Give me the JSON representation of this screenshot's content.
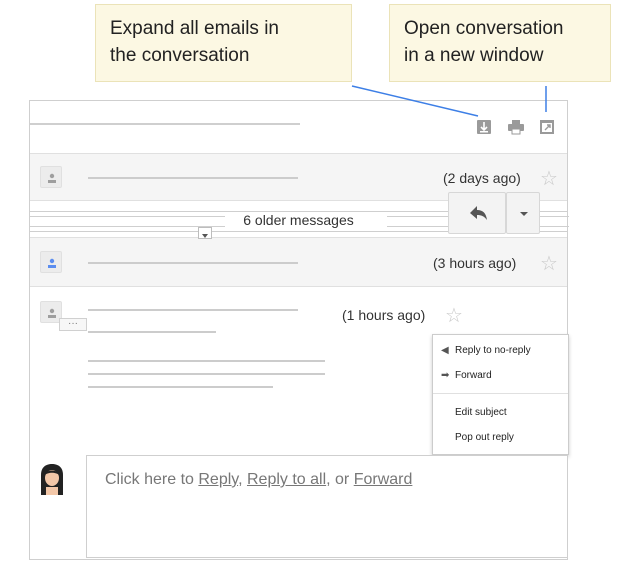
{
  "callouts": {
    "expand": {
      "line1": "Expand all emails in",
      "line2": "the conversation"
    },
    "open": {
      "line1": "Open conversation",
      "line2": "in a new window"
    }
  },
  "toolbar": {
    "icons": [
      "expand-all-icon",
      "print-icon",
      "open-in-new-window-icon"
    ]
  },
  "messages": [
    {
      "time": "(2 days ago)",
      "state": "collapsed",
      "avatar_color": "#9e9e9e"
    },
    {
      "time": "(3 hours ago)",
      "state": "collapsed",
      "avatar_color": "#5b8def"
    },
    {
      "time": "(1 hours ago)",
      "state": "expanded",
      "avatar_color": "#9e9e9e"
    }
  ],
  "older_messages": {
    "label": "6 older messages"
  },
  "expanded_message": {
    "trimmed_content": "···"
  },
  "menu": {
    "items": [
      {
        "label": "Reply to no-reply",
        "icon": "reply-icon"
      },
      {
        "label": "Forward",
        "icon": "forward-icon"
      },
      {
        "label": "Edit subject"
      },
      {
        "label": "Pop out reply"
      }
    ]
  },
  "reply_box": {
    "prefix": "Click here to ",
    "reply": "Reply",
    "sep1": ", ",
    "reply_all": "Reply to all",
    "sep2": ", or ",
    "forward": "Forward"
  },
  "colors": {
    "callout_bg": "#fcf8e3",
    "pointer_line": "#3d7fe6",
    "collapsed_row_bg": "#f5f5f5",
    "star": "#c8c8c8"
  }
}
